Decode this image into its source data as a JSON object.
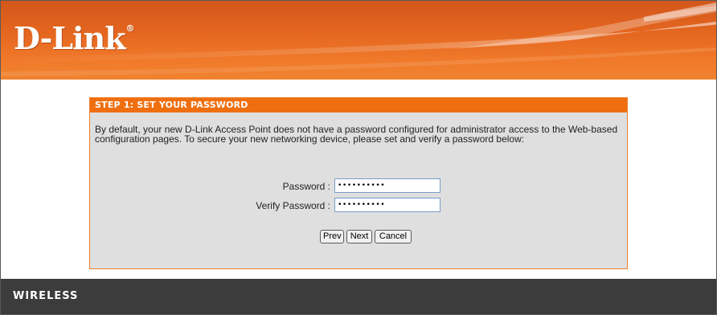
{
  "brand": {
    "logo_text": "D-Link",
    "logo_mark": "®"
  },
  "step": {
    "title": "STEP 1: SET YOUR PASSWORD",
    "description": "By default, your new D-Link Access Point does not have a password configured for administrator access to the Web-based configuration pages. To secure your new networking device, please set and verify a password below:"
  },
  "form": {
    "password_label": "Password :",
    "password_value": "••••••••••",
    "verify_label": "Verify Password :",
    "verify_value": "••••••••••"
  },
  "buttons": {
    "prev": "Prev",
    "next": "Next",
    "cancel": "Cancel"
  },
  "footer": {
    "label": "WIRELESS"
  },
  "colors": {
    "header_orange": "#e4661f",
    "panel_header": "#ef6f10",
    "panel_bg": "#dfdfdf",
    "footer_bg": "#3c3c3c"
  }
}
